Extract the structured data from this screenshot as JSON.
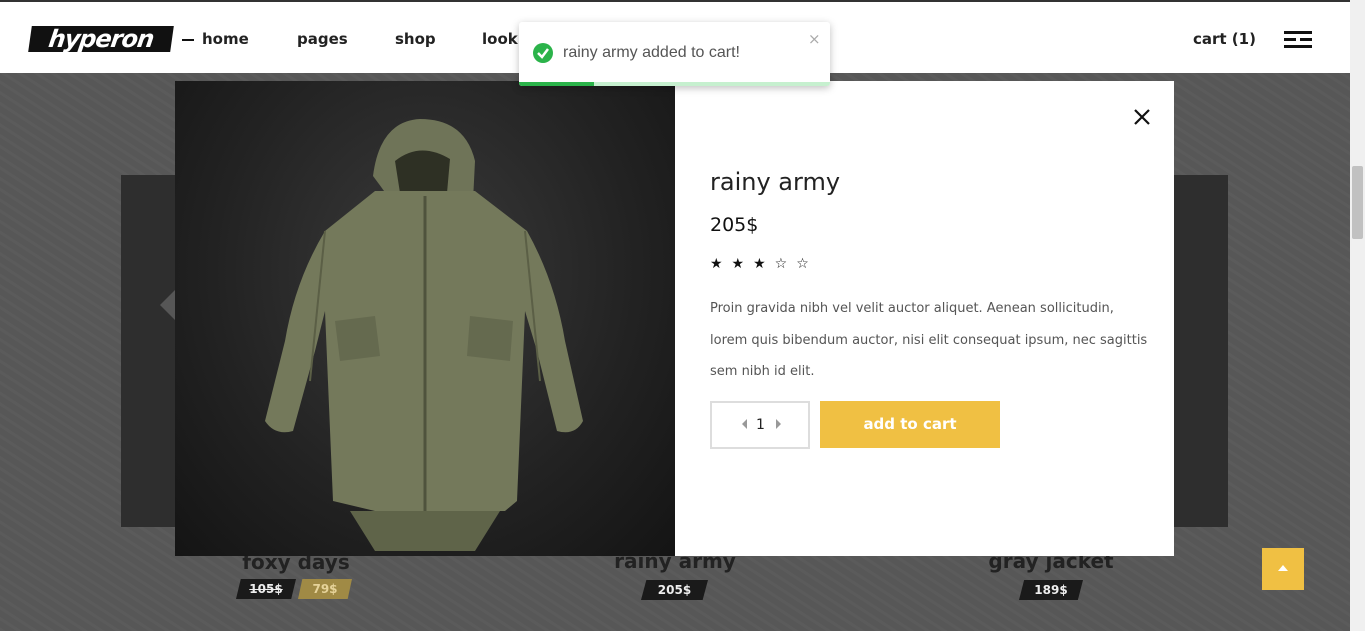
{
  "header": {
    "logo": "hyperon",
    "nav": [
      "home",
      "pages",
      "shop",
      "lookbook"
    ],
    "cart": "cart (1)"
  },
  "toast": {
    "message": "rainy army added to cart!",
    "close": "×",
    "progress": 0.24,
    "color": "#2bb34a"
  },
  "modal": {
    "title": "rainy army",
    "price": "205$",
    "rating": 3,
    "rating_max": 5,
    "stars": "★★★☆☆",
    "description": "Proin gravida nibh vel velit auctor aliquet. Aenean sollicitudin, lorem quis bibendum auctor, nisi elit consequat ipsum, nec sagittis sem nibh id elit.",
    "quantity": "1",
    "add_to_cart": "add to cart",
    "accent": "#f0c043"
  },
  "products": [
    {
      "name": "foxy days",
      "old_price": "105$",
      "price": "79$"
    },
    {
      "name": "rainy army",
      "price": "205$"
    },
    {
      "name": "gray jacket",
      "price": "189$"
    }
  ],
  "icons": {
    "close": "close-icon",
    "check": "check-icon",
    "menu": "hamburger-icon",
    "scroll_top": "arrow-up-icon"
  }
}
